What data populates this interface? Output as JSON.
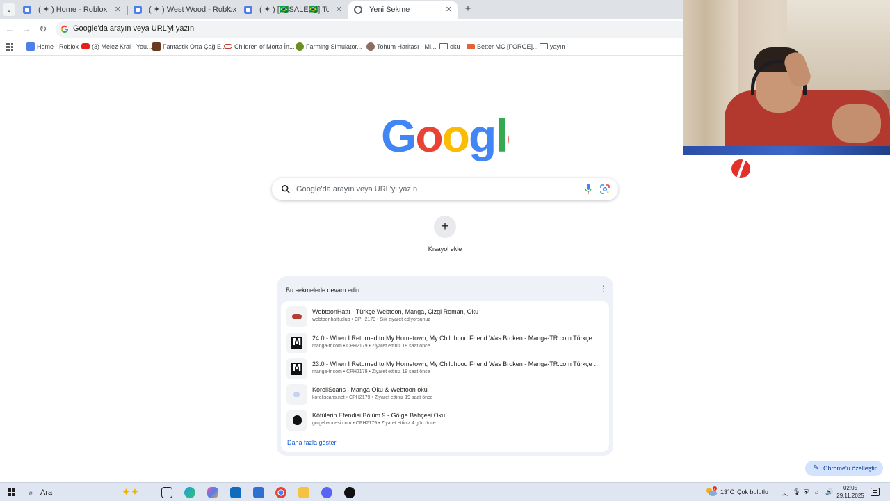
{
  "browser": {
    "tabs": [
      {
        "title": "( ✦ ) Home - Roblox",
        "active": false
      },
      {
        "title": "( ✦ ) West Wood - Roblox",
        "active": false
      },
      {
        "title": "( ✦ ) [🇧🇷SALE🇧🇷] Tower Defense",
        "active": false
      },
      {
        "title": "Yeni Sekme",
        "active": true
      }
    ],
    "address_placeholder": "Google'da arayın veya URL'yi yazın",
    "bookmarks": [
      {
        "label": "Home - Roblox",
        "icon": "roblox-icon"
      },
      {
        "label": "(3) Melez Kral - You...",
        "icon": "youtube-icon"
      },
      {
        "label": "Fantastik Orta Çağ E...",
        "icon": "book-icon"
      },
      {
        "label": "Children of Morta İn...",
        "icon": "mask-icon"
      },
      {
        "label": "Farming Simulator...",
        "icon": "farming-icon"
      },
      {
        "label": "Tohum Haritası - Mi...",
        "icon": "seed-map-icon"
      },
      {
        "label": "oku",
        "icon": "folder-icon"
      },
      {
        "label": "Better MC [FORGE]...",
        "icon": "curseforge-icon"
      },
      {
        "label": "yayın",
        "icon": "folder-icon"
      }
    ]
  },
  "newtab": {
    "search_placeholder": "Google'da arayın veya URL'yi yazın",
    "shortcut_label": "Kısayol ekle",
    "continue": {
      "header": "Bu sekmelerle devam edin",
      "items": [
        {
          "title": "WebtoonHattı - Türkçe Webtoon, Manga, Çizgi Roman, Oku",
          "sub": "webtoonhatti.club • CPH2179 • Sık ziyaret ediyorsunuz",
          "icon": "webtoonhatti-icon"
        },
        {
          "title": "24.0 - When I Returned to My Hometown, My Childhood Friend Was Broken - Manga-TR.com Türkçe Çevrimi...",
          "sub": "manga-tr.com • CPH2179 • Ziyaret ettiniz 18 saat önce",
          "icon": "manga-tr-icon"
        },
        {
          "title": "23.0 - When I Returned to My Hometown, My Childhood Friend Was Broken - Manga-TR.com Türkçe Çevrimi...",
          "sub": "manga-tr.com • CPH2179 • Ziyaret ettiniz 18 saat önce",
          "icon": "manga-tr-icon"
        },
        {
          "title": "KoreliScans | Manga Oku & Webtoon oku",
          "sub": "koreliscans.net • CPH2179 • Ziyaret ettiniz 19 saat önce",
          "icon": "koreliscans-icon"
        },
        {
          "title": "Kötülerin Efendisi Bölüm 9 - Gölge Bahçesi Oku",
          "sub": "golgebahcesi.com • CPH2179 • Ziyaret ettiniz 4 gün önce",
          "icon": "golgebahcesi-icon"
        }
      ],
      "show_more": "Daha fazla göster"
    },
    "customize_label": "Chrome'u özelleştir"
  },
  "taskbar": {
    "search_placeholder": "Ara",
    "weather_temp": "13°C",
    "weather_desc": "Çok bulutlu",
    "weather_badge": "1",
    "time": "02:05",
    "date": "29.11.2025"
  },
  "colors": {
    "google_blue": "#4285F4",
    "google_red": "#EA4335",
    "google_yellow": "#FBBC05",
    "google_green": "#34A853",
    "link_blue": "#0b57d0"
  }
}
